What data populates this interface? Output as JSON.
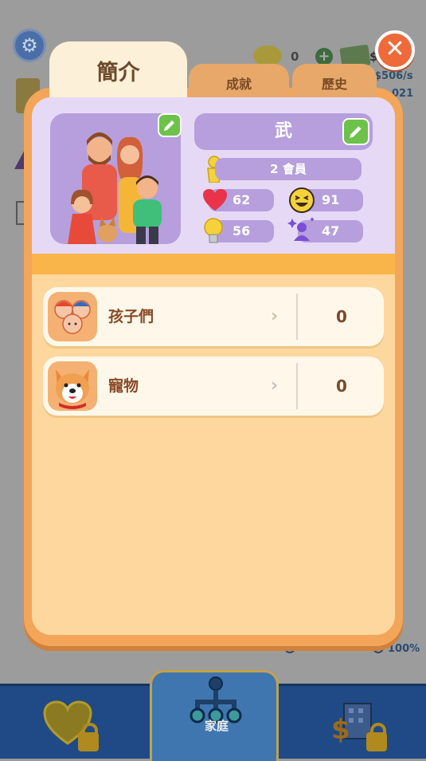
{
  "background": {
    "coin_value": "0",
    "income_rate": "$506/s",
    "year_fragment": "021",
    "money_fragment": "$",
    "progress_label": "100%"
  },
  "tabs": [
    {
      "label": "簡介",
      "active": true
    },
    {
      "label": "成就",
      "active": false
    },
    {
      "label": "歷史",
      "active": false
    }
  ],
  "profile": {
    "family_name": "武",
    "members": "2 會員",
    "stats": {
      "health": "62",
      "happiness": "91",
      "intelligence": "56",
      "social": "47"
    }
  },
  "sections": [
    {
      "label": "孩子們",
      "count": "0",
      "icon": "children-icon"
    },
    {
      "label": "寵物",
      "count": "0",
      "icon": "corgi-icon"
    }
  ],
  "bottom_nav": {
    "family_label": "家庭"
  },
  "colors": {
    "panel_orange": "#f3a559",
    "card_purple": "#b69fdc",
    "pencil_green": "#6cc24a",
    "close_orange": "#ee6a3a",
    "nav_blue": "#1f4a86"
  }
}
